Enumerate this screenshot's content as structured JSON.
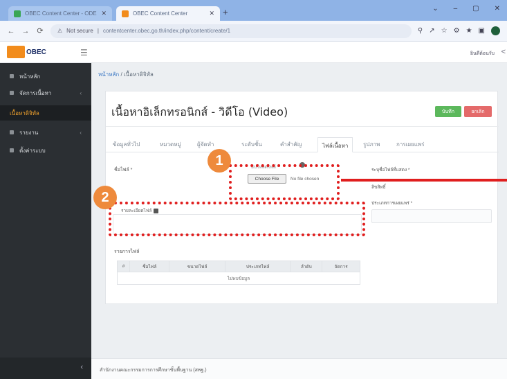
{
  "browser": {
    "tabs": [
      {
        "title": "OBEC Content Center - ODE",
        "active": false,
        "favicon_color": "#3aa655"
      },
      {
        "title": "OBEC Content Center",
        "active": true,
        "favicon_color": "#f28c1c"
      }
    ],
    "new_tab": "+",
    "window_controls": [
      "⌄",
      "–",
      "▢",
      "✕"
    ],
    "nav": {
      "back": "←",
      "forward": "→",
      "reload": "⟳"
    },
    "url_prefix": "Not secure",
    "url": "contentcenter.obec.go.th/index.php/content/create/1",
    "extensions": [
      "⚲",
      "↗",
      "☆",
      "⚙",
      "★",
      "▣"
    ]
  },
  "app": {
    "logo_text": "OBEC",
    "user_link": "ยินดีต้อนรับ",
    "header_edge": "<"
  },
  "sidebar": {
    "items": [
      {
        "label": "หน้าหลัก",
        "active": false,
        "has_children": false
      },
      {
        "label": "จัดการเนื้อหา",
        "active": false,
        "has_children": true
      },
      {
        "label": "เนื้อหาดิจิทัล",
        "active": true,
        "has_children": false
      },
      {
        "label": "รายงาน",
        "active": false,
        "has_children": true
      },
      {
        "label": "ตั้งค่าระบบ",
        "active": false,
        "has_children": false
      }
    ],
    "collapse": "‹"
  },
  "breadcrumb": {
    "root": "หน้าหลัก",
    "sep": " / ",
    "current": "เนื้อหาดิจิทัล"
  },
  "page": {
    "title": "เนื้อหาอิเล็กทรอนิกส์ - วิดีโอ (Video)"
  },
  "actions": {
    "save": "บันทึก",
    "cancel": "ยกเลิก"
  },
  "form_tabs": [
    {
      "label": "ข้อมูลทั่วไป",
      "active": false
    },
    {
      "label": "หมวดหมู่",
      "active": false
    },
    {
      "label": "ผู้จัดทำ",
      "active": false
    },
    {
      "label": "ระดับชั้น",
      "active": false
    },
    {
      "label": "คำสำคัญ",
      "active": false
    },
    {
      "label": "ไฟล์เนื้อหา",
      "active": true
    },
    {
      "label": "รูปภาพ",
      "active": false
    },
    {
      "label": "การเผยแพร่",
      "active": false
    }
  ],
  "fields": {
    "file_name_label": "ชื่อไฟล์ *",
    "upload_label": "อัปโหลดไฟล์ *",
    "choose_file": "Choose File",
    "no_file": "No file chosen",
    "description_label": "รายละเอียดไฟล์",
    "right_label_1": "ระบุชื่อไฟล์ที่แสดง *",
    "right_label_2": "ลิขสิทธิ์",
    "right_label_3": "ประเภทการเผยแพร่ *"
  },
  "attachments": {
    "title": "รายการไฟล์",
    "columns": [
      "#",
      "ชื่อไฟล์",
      "ขนาดไฟล์",
      "ประเภทไฟล์",
      "ลำดับ",
      "จัดการ"
    ],
    "empty_text": "ไม่พบข้อมูล"
  },
  "annotations": {
    "badge_1": "1",
    "badge_2": "2",
    "highlight_color": "#e01e1e",
    "badge_color": "#ee8a3c"
  },
  "footer": {
    "text": "สำนักงานคณะกรรมการการศึกษาขั้นพื้นฐาน (สพฐ.)"
  }
}
